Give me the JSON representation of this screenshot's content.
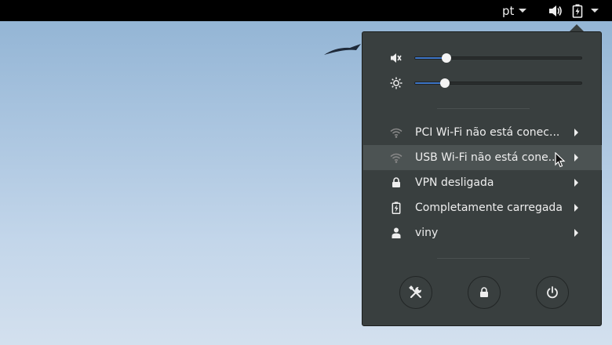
{
  "topbar": {
    "language": "pt",
    "icons": [
      "speaker-icon",
      "battery-charging-icon"
    ]
  },
  "sliders": {
    "volume": {
      "icon": "volume-icon",
      "value": 0.19
    },
    "brightness": {
      "icon": "brightness-icon",
      "value": 0.18
    }
  },
  "menu": {
    "items": [
      {
        "label": "PCI Wi-Fi não está conec...",
        "icon": "wifi-icon"
      },
      {
        "label": "USB Wi-Fi não está cone...",
        "icon": "wifi-icon"
      },
      {
        "label": "VPN desligada",
        "icon": "vpn-lock-icon"
      },
      {
        "label": "Completamente carregada",
        "icon": "battery-icon"
      },
      {
        "label": "viny",
        "icon": "user-icon"
      }
    ],
    "buttons": [
      "settings-icon",
      "lock-icon",
      "power-icon"
    ]
  },
  "colors": {
    "accent": "#3c74c6",
    "menu_bg": "#393f3f",
    "hover": "#4c5353"
  }
}
